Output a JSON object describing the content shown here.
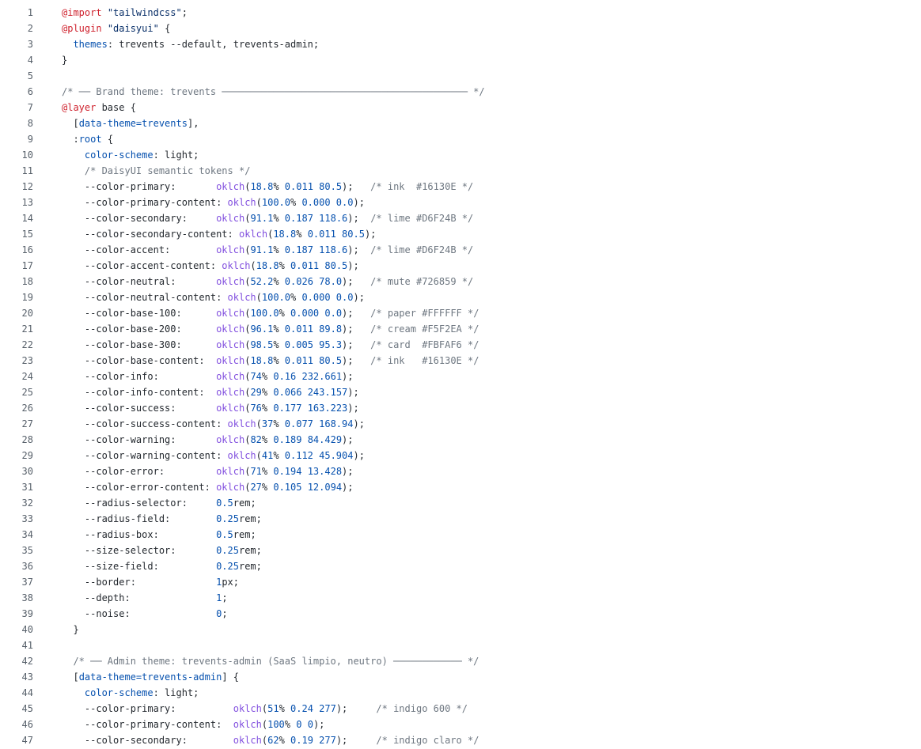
{
  "lines": [
    {
      "n": "1",
      "t": [
        [
          "at",
          "@import"
        ],
        [
          "pl",
          " "
        ],
        [
          "str",
          "\"tailwindcss\""
        ],
        [
          "pl",
          ";"
        ]
      ]
    },
    {
      "n": "2",
      "t": [
        [
          "at",
          "@plugin"
        ],
        [
          "pl",
          " "
        ],
        [
          "str",
          "\"daisyui\""
        ],
        [
          "pl",
          " {"
        ]
      ]
    },
    {
      "n": "3",
      "t": [
        [
          "pl",
          "  "
        ],
        [
          "prop",
          "themes"
        ],
        [
          "pl",
          ": trevents --default, trevents-admin;"
        ]
      ]
    },
    {
      "n": "4",
      "t": [
        [
          "pl",
          "}"
        ]
      ]
    },
    {
      "n": "5",
      "t": []
    },
    {
      "n": "6",
      "t": [
        [
          "com",
          "/* ── Brand theme: trevents ─────────────────────────────────────────── */"
        ]
      ]
    },
    {
      "n": "7",
      "t": [
        [
          "at",
          "@layer"
        ],
        [
          "pl",
          " base {"
        ]
      ]
    },
    {
      "n": "8",
      "t": [
        [
          "pl",
          "  ["
        ],
        [
          "sel",
          "data-theme=trevents"
        ],
        [
          "pl",
          "],"
        ]
      ]
    },
    {
      "n": "9",
      "t": [
        [
          "pl",
          "  :"
        ],
        [
          "sel",
          "root"
        ],
        [
          "pl",
          " {"
        ]
      ]
    },
    {
      "n": "10",
      "t": [
        [
          "pl",
          "    "
        ],
        [
          "prop",
          "color-scheme"
        ],
        [
          "pl",
          ": light;"
        ]
      ]
    },
    {
      "n": "11",
      "t": [
        [
          "pl",
          "    "
        ],
        [
          "com",
          "/* DaisyUI semantic tokens */"
        ]
      ]
    },
    {
      "n": "12",
      "t": [
        [
          "pl",
          "    --color-primary:       "
        ],
        [
          "fn",
          "oklch"
        ],
        [
          "pl",
          "("
        ],
        [
          "num",
          "18.8"
        ],
        [
          "pl",
          "% "
        ],
        [
          "num",
          "0.011 80.5"
        ],
        [
          "pl",
          ");   "
        ],
        [
          "com",
          "/* ink  #16130E */"
        ]
      ]
    },
    {
      "n": "13",
      "t": [
        [
          "pl",
          "    --color-primary-content: "
        ],
        [
          "fn",
          "oklch"
        ],
        [
          "pl",
          "("
        ],
        [
          "num",
          "100.0"
        ],
        [
          "pl",
          "% "
        ],
        [
          "num",
          "0.000 0.0"
        ],
        [
          "pl",
          ");"
        ]
      ]
    },
    {
      "n": "14",
      "t": [
        [
          "pl",
          "    --color-secondary:     "
        ],
        [
          "fn",
          "oklch"
        ],
        [
          "pl",
          "("
        ],
        [
          "num",
          "91.1"
        ],
        [
          "pl",
          "% "
        ],
        [
          "num",
          "0.187 118.6"
        ],
        [
          "pl",
          ");  "
        ],
        [
          "com",
          "/* lime #D6F24B */"
        ]
      ]
    },
    {
      "n": "15",
      "t": [
        [
          "pl",
          "    --color-secondary-content: "
        ],
        [
          "fn",
          "oklch"
        ],
        [
          "pl",
          "("
        ],
        [
          "num",
          "18.8"
        ],
        [
          "pl",
          "% "
        ],
        [
          "num",
          "0.011 80.5"
        ],
        [
          "pl",
          ");"
        ]
      ]
    },
    {
      "n": "16",
      "t": [
        [
          "pl",
          "    --color-accent:        "
        ],
        [
          "fn",
          "oklch"
        ],
        [
          "pl",
          "("
        ],
        [
          "num",
          "91.1"
        ],
        [
          "pl",
          "% "
        ],
        [
          "num",
          "0.187 118.6"
        ],
        [
          "pl",
          ");  "
        ],
        [
          "com",
          "/* lime #D6F24B */"
        ]
      ]
    },
    {
      "n": "17",
      "t": [
        [
          "pl",
          "    --color-accent-content: "
        ],
        [
          "fn",
          "oklch"
        ],
        [
          "pl",
          "("
        ],
        [
          "num",
          "18.8"
        ],
        [
          "pl",
          "% "
        ],
        [
          "num",
          "0.011 80.5"
        ],
        [
          "pl",
          ");"
        ]
      ]
    },
    {
      "n": "18",
      "t": [
        [
          "pl",
          "    --color-neutral:       "
        ],
        [
          "fn",
          "oklch"
        ],
        [
          "pl",
          "("
        ],
        [
          "num",
          "52.2"
        ],
        [
          "pl",
          "% "
        ],
        [
          "num",
          "0.026 78.0"
        ],
        [
          "pl",
          ");   "
        ],
        [
          "com",
          "/* mute #726859 */"
        ]
      ]
    },
    {
      "n": "19",
      "t": [
        [
          "pl",
          "    --color-neutral-content: "
        ],
        [
          "fn",
          "oklch"
        ],
        [
          "pl",
          "("
        ],
        [
          "num",
          "100.0"
        ],
        [
          "pl",
          "% "
        ],
        [
          "num",
          "0.000 0.0"
        ],
        [
          "pl",
          ");"
        ]
      ]
    },
    {
      "n": "20",
      "t": [
        [
          "pl",
          "    --color-base-100:      "
        ],
        [
          "fn",
          "oklch"
        ],
        [
          "pl",
          "("
        ],
        [
          "num",
          "100.0"
        ],
        [
          "pl",
          "% "
        ],
        [
          "num",
          "0.000 0.0"
        ],
        [
          "pl",
          ");   "
        ],
        [
          "com",
          "/* paper #FFFFFF */"
        ]
      ]
    },
    {
      "n": "21",
      "t": [
        [
          "pl",
          "    --color-base-200:      "
        ],
        [
          "fn",
          "oklch"
        ],
        [
          "pl",
          "("
        ],
        [
          "num",
          "96.1"
        ],
        [
          "pl",
          "% "
        ],
        [
          "num",
          "0.011 89.8"
        ],
        [
          "pl",
          ");   "
        ],
        [
          "com",
          "/* cream #F5F2EA */"
        ]
      ]
    },
    {
      "n": "22",
      "t": [
        [
          "pl",
          "    --color-base-300:      "
        ],
        [
          "fn",
          "oklch"
        ],
        [
          "pl",
          "("
        ],
        [
          "num",
          "98.5"
        ],
        [
          "pl",
          "% "
        ],
        [
          "num",
          "0.005 95.3"
        ],
        [
          "pl",
          ");   "
        ],
        [
          "com",
          "/* card  #FBFAF6 */"
        ]
      ]
    },
    {
      "n": "23",
      "t": [
        [
          "pl",
          "    --color-base-content:  "
        ],
        [
          "fn",
          "oklch"
        ],
        [
          "pl",
          "("
        ],
        [
          "num",
          "18.8"
        ],
        [
          "pl",
          "% "
        ],
        [
          "num",
          "0.011 80.5"
        ],
        [
          "pl",
          ");   "
        ],
        [
          "com",
          "/* ink   #16130E */"
        ]
      ]
    },
    {
      "n": "24",
      "t": [
        [
          "pl",
          "    --color-info:          "
        ],
        [
          "fn",
          "oklch"
        ],
        [
          "pl",
          "("
        ],
        [
          "num",
          "74"
        ],
        [
          "pl",
          "% "
        ],
        [
          "num",
          "0.16 232.661"
        ],
        [
          "pl",
          ");"
        ]
      ]
    },
    {
      "n": "25",
      "t": [
        [
          "pl",
          "    --color-info-content:  "
        ],
        [
          "fn",
          "oklch"
        ],
        [
          "pl",
          "("
        ],
        [
          "num",
          "29"
        ],
        [
          "pl",
          "% "
        ],
        [
          "num",
          "0.066 243.157"
        ],
        [
          "pl",
          ");"
        ]
      ]
    },
    {
      "n": "26",
      "t": [
        [
          "pl",
          "    --color-success:       "
        ],
        [
          "fn",
          "oklch"
        ],
        [
          "pl",
          "("
        ],
        [
          "num",
          "76"
        ],
        [
          "pl",
          "% "
        ],
        [
          "num",
          "0.177 163.223"
        ],
        [
          "pl",
          ");"
        ]
      ]
    },
    {
      "n": "27",
      "t": [
        [
          "pl",
          "    --color-success-content: "
        ],
        [
          "fn",
          "oklch"
        ],
        [
          "pl",
          "("
        ],
        [
          "num",
          "37"
        ],
        [
          "pl",
          "% "
        ],
        [
          "num",
          "0.077 168.94"
        ],
        [
          "pl",
          ");"
        ]
      ]
    },
    {
      "n": "28",
      "t": [
        [
          "pl",
          "    --color-warning:       "
        ],
        [
          "fn",
          "oklch"
        ],
        [
          "pl",
          "("
        ],
        [
          "num",
          "82"
        ],
        [
          "pl",
          "% "
        ],
        [
          "num",
          "0.189 84.429"
        ],
        [
          "pl",
          ");"
        ]
      ]
    },
    {
      "n": "29",
      "t": [
        [
          "pl",
          "    --color-warning-content: "
        ],
        [
          "fn",
          "oklch"
        ],
        [
          "pl",
          "("
        ],
        [
          "num",
          "41"
        ],
        [
          "pl",
          "% "
        ],
        [
          "num",
          "0.112 45.904"
        ],
        [
          "pl",
          ");"
        ]
      ]
    },
    {
      "n": "30",
      "t": [
        [
          "pl",
          "    --color-error:         "
        ],
        [
          "fn",
          "oklch"
        ],
        [
          "pl",
          "("
        ],
        [
          "num",
          "71"
        ],
        [
          "pl",
          "% "
        ],
        [
          "num",
          "0.194 13.428"
        ],
        [
          "pl",
          ");"
        ]
      ]
    },
    {
      "n": "31",
      "t": [
        [
          "pl",
          "    --color-error-content: "
        ],
        [
          "fn",
          "oklch"
        ],
        [
          "pl",
          "("
        ],
        [
          "num",
          "27"
        ],
        [
          "pl",
          "% "
        ],
        [
          "num",
          "0.105 12.094"
        ],
        [
          "pl",
          ");"
        ]
      ]
    },
    {
      "n": "32",
      "t": [
        [
          "pl",
          "    --radius-selector:     "
        ],
        [
          "num",
          "0.5"
        ],
        [
          "pl",
          "rem;"
        ]
      ]
    },
    {
      "n": "33",
      "t": [
        [
          "pl",
          "    --radius-field:        "
        ],
        [
          "num",
          "0.25"
        ],
        [
          "pl",
          "rem;"
        ]
      ]
    },
    {
      "n": "34",
      "t": [
        [
          "pl",
          "    --radius-box:          "
        ],
        [
          "num",
          "0.5"
        ],
        [
          "pl",
          "rem;"
        ]
      ]
    },
    {
      "n": "35",
      "t": [
        [
          "pl",
          "    --size-selector:       "
        ],
        [
          "num",
          "0.25"
        ],
        [
          "pl",
          "rem;"
        ]
      ]
    },
    {
      "n": "36",
      "t": [
        [
          "pl",
          "    --size-field:          "
        ],
        [
          "num",
          "0.25"
        ],
        [
          "pl",
          "rem;"
        ]
      ]
    },
    {
      "n": "37",
      "t": [
        [
          "pl",
          "    --border:              "
        ],
        [
          "num",
          "1"
        ],
        [
          "pl",
          "px;"
        ]
      ]
    },
    {
      "n": "38",
      "t": [
        [
          "pl",
          "    --depth:               "
        ],
        [
          "num",
          "1"
        ],
        [
          "pl",
          ";"
        ]
      ]
    },
    {
      "n": "39",
      "t": [
        [
          "pl",
          "    --noise:               "
        ],
        [
          "num",
          "0"
        ],
        [
          "pl",
          ";"
        ]
      ]
    },
    {
      "n": "40",
      "t": [
        [
          "pl",
          "  }"
        ]
      ]
    },
    {
      "n": "41",
      "t": []
    },
    {
      "n": "42",
      "t": [
        [
          "pl",
          "  "
        ],
        [
          "com",
          "/* ── Admin theme: trevents-admin (SaaS limpio, neutro) ──────────── */"
        ]
      ]
    },
    {
      "n": "43",
      "t": [
        [
          "pl",
          "  ["
        ],
        [
          "sel",
          "data-theme=trevents-admin"
        ],
        [
          "pl",
          "] {"
        ]
      ]
    },
    {
      "n": "44",
      "t": [
        [
          "pl",
          "    "
        ],
        [
          "prop",
          "color-scheme"
        ],
        [
          "pl",
          ": light;"
        ]
      ]
    },
    {
      "n": "45",
      "t": [
        [
          "pl",
          "    --color-primary:          "
        ],
        [
          "fn",
          "oklch"
        ],
        [
          "pl",
          "("
        ],
        [
          "num",
          "51"
        ],
        [
          "pl",
          "% "
        ],
        [
          "num",
          "0.24 277"
        ],
        [
          "pl",
          ");     "
        ],
        [
          "com",
          "/* indigo 600 */"
        ]
      ]
    },
    {
      "n": "46",
      "t": [
        [
          "pl",
          "    --color-primary-content:  "
        ],
        [
          "fn",
          "oklch"
        ],
        [
          "pl",
          "("
        ],
        [
          "num",
          "100"
        ],
        [
          "pl",
          "% "
        ],
        [
          "num",
          "0 0"
        ],
        [
          "pl",
          ");"
        ]
      ]
    },
    {
      "n": "47",
      "t": [
        [
          "pl",
          "    --color-secondary:        "
        ],
        [
          "fn",
          "oklch"
        ],
        [
          "pl",
          "("
        ],
        [
          "num",
          "62"
        ],
        [
          "pl",
          "% "
        ],
        [
          "num",
          "0.19 277"
        ],
        [
          "pl",
          ");     "
        ],
        [
          "com",
          "/* indigo claro */"
        ]
      ]
    }
  ]
}
